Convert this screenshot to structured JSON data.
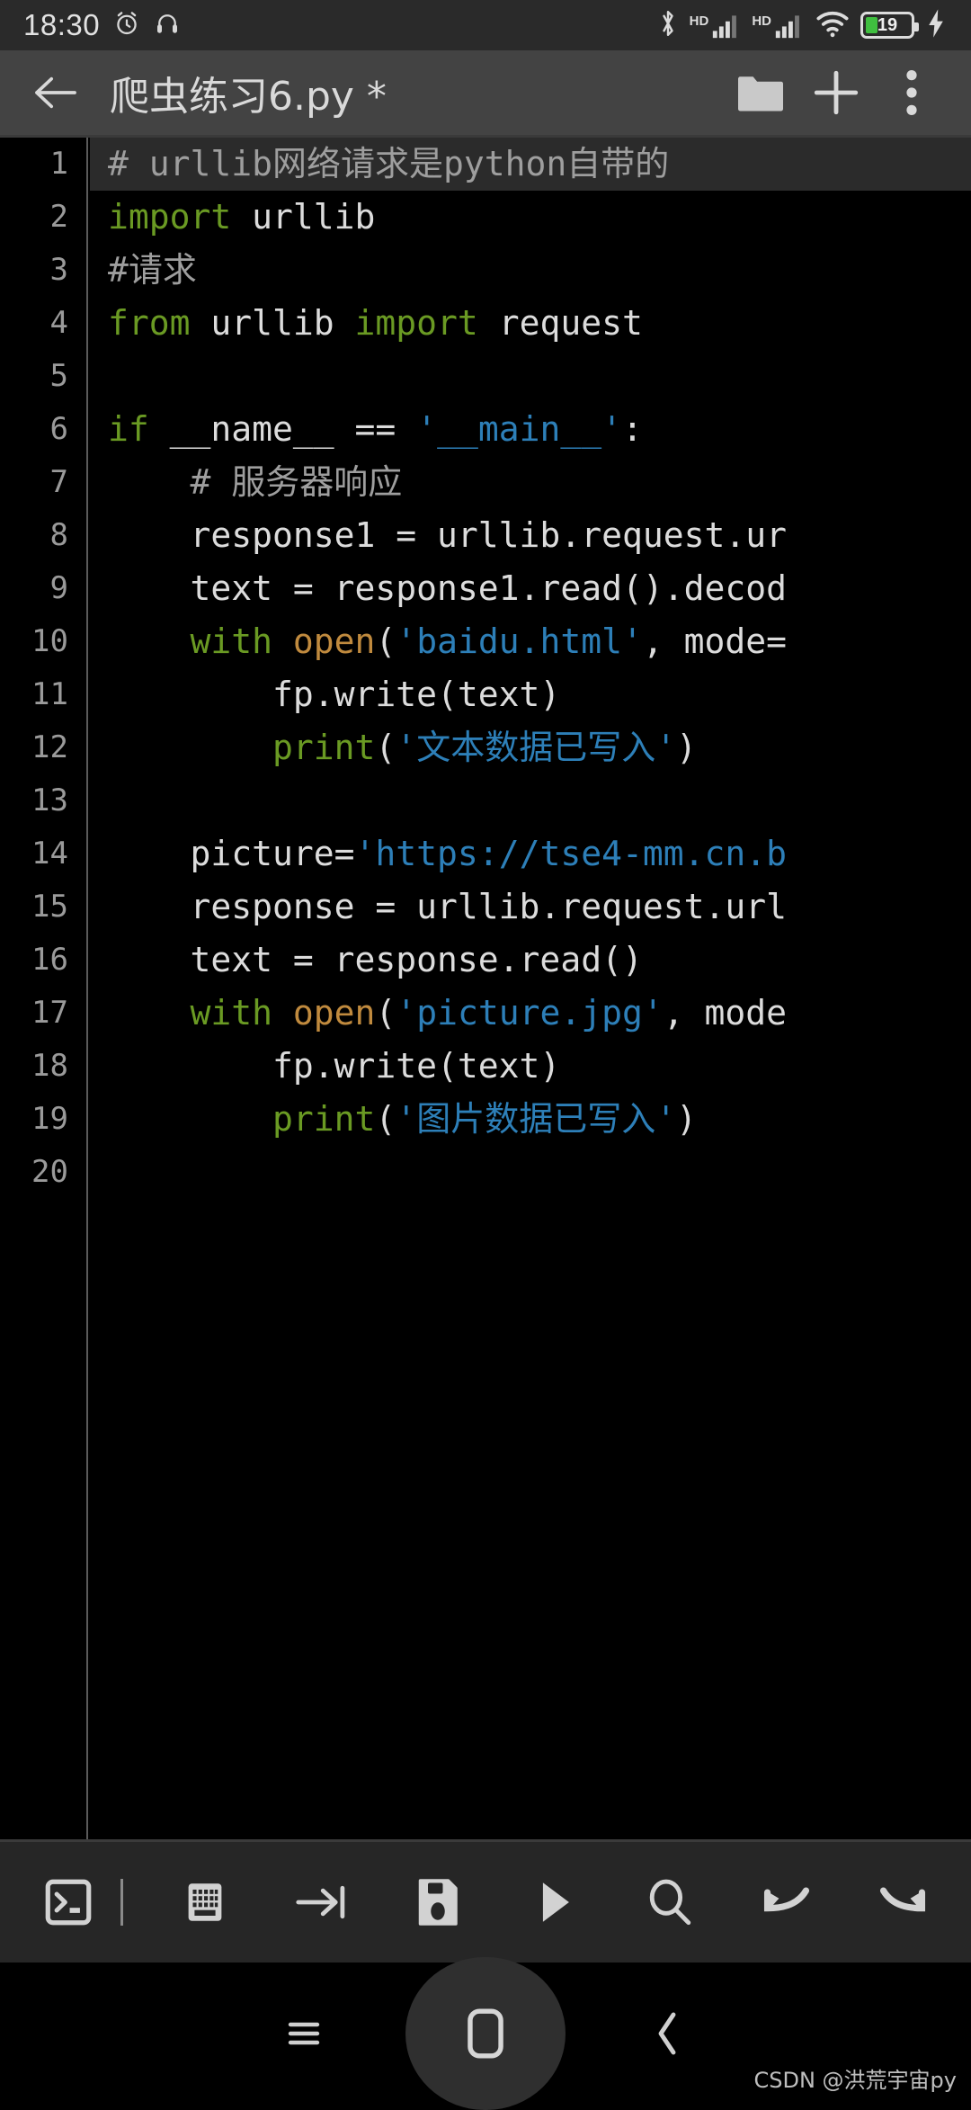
{
  "status_bar": {
    "time": "18:30",
    "icons_left": [
      "alarm-clock-icon",
      "headphones-icon"
    ],
    "icons_right": [
      "bluetooth-icon",
      "signal-hd-1-icon",
      "signal-hd-2-icon",
      "wifi-icon",
      "battery-icon",
      "charging-bolt-icon"
    ],
    "hd_label_1": "HD",
    "hd_label_2": "HD",
    "battery_percent": "19",
    "battery_color": "#3fbf3f"
  },
  "app_bar": {
    "back_icon": "arrow-left-icon",
    "title": "爬虫练习6.py *",
    "actions": [
      {
        "name": "folder-open-icon",
        "label": "folder"
      },
      {
        "name": "add-new-file-icon",
        "label": "+"
      },
      {
        "name": "overflow-menu-icon",
        "label": "⋮"
      }
    ]
  },
  "editor": {
    "current_line": 1,
    "total_lines": 20,
    "line_numbers": [
      "1",
      "2",
      "3",
      "4",
      "5",
      "6",
      "7",
      "8",
      "9",
      "10",
      "11",
      "12",
      "13",
      "14",
      "15",
      "16",
      "17",
      "18",
      "19",
      "20"
    ],
    "lines": [
      {
        "n": 1,
        "tokens": [
          {
            "t": "# urllib网络请求是python自带的",
            "c": "cmt"
          }
        ]
      },
      {
        "n": 2,
        "tokens": [
          {
            "t": "import",
            "c": "kw"
          },
          {
            "t": " urllib",
            "c": "def"
          }
        ]
      },
      {
        "n": 3,
        "tokens": [
          {
            "t": "#请求",
            "c": "cmt"
          }
        ]
      },
      {
        "n": 4,
        "tokens": [
          {
            "t": "from",
            "c": "kw"
          },
          {
            "t": " urllib ",
            "c": "def"
          },
          {
            "t": "import",
            "c": "kw"
          },
          {
            "t": " request",
            "c": "def"
          }
        ]
      },
      {
        "n": 5,
        "tokens": []
      },
      {
        "n": 6,
        "tokens": [
          {
            "t": "if",
            "c": "kw"
          },
          {
            "t": " __name__ == ",
            "c": "def"
          },
          {
            "t": "'__main__'",
            "c": "str"
          },
          {
            "t": ":",
            "c": "def"
          }
        ]
      },
      {
        "n": 7,
        "tokens": [
          {
            "t": "    # 服务器响应",
            "c": "cmt"
          }
        ]
      },
      {
        "n": 8,
        "tokens": [
          {
            "t": "    response1 = urllib.request.ur",
            "c": "def"
          }
        ]
      },
      {
        "n": 9,
        "tokens": [
          {
            "t": "    text = response1.read().decod",
            "c": "def"
          }
        ]
      },
      {
        "n": 10,
        "tokens": [
          {
            "t": "    ",
            "c": "def"
          },
          {
            "t": "with",
            "c": "kw"
          },
          {
            "t": " ",
            "c": "def"
          },
          {
            "t": "open",
            "c": "fn"
          },
          {
            "t": "(",
            "c": "def"
          },
          {
            "t": "'baidu.html'",
            "c": "str"
          },
          {
            "t": ", mode=",
            "c": "def"
          }
        ]
      },
      {
        "n": 11,
        "tokens": [
          {
            "t": "        fp.write(text)",
            "c": "def"
          }
        ]
      },
      {
        "n": 12,
        "tokens": [
          {
            "t": "        ",
            "c": "def"
          },
          {
            "t": "print",
            "c": "kw"
          },
          {
            "t": "(",
            "c": "def"
          },
          {
            "t": "'文本数据已写入'",
            "c": "str"
          },
          {
            "t": ")",
            "c": "def"
          }
        ]
      },
      {
        "n": 13,
        "tokens": []
      },
      {
        "n": 14,
        "tokens": [
          {
            "t": "    picture=",
            "c": "def"
          },
          {
            "t": "'https://tse4-mm.cn.b",
            "c": "str"
          }
        ]
      },
      {
        "n": 15,
        "tokens": [
          {
            "t": "    response = urllib.request.url",
            "c": "def"
          }
        ]
      },
      {
        "n": 16,
        "tokens": [
          {
            "t": "    text = response.read()",
            "c": "def"
          }
        ]
      },
      {
        "n": 17,
        "tokens": [
          {
            "t": "    ",
            "c": "def"
          },
          {
            "t": "with",
            "c": "kw"
          },
          {
            "t": " ",
            "c": "def"
          },
          {
            "t": "open",
            "c": "fn"
          },
          {
            "t": "(",
            "c": "def"
          },
          {
            "t": "'picture.jpg'",
            "c": "str"
          },
          {
            "t": ", mode",
            "c": "def"
          }
        ]
      },
      {
        "n": 18,
        "tokens": [
          {
            "t": "        fp.write(text)",
            "c": "def"
          }
        ]
      },
      {
        "n": 19,
        "tokens": [
          {
            "t": "        ",
            "c": "def"
          },
          {
            "t": "print",
            "c": "kw"
          },
          {
            "t": "(",
            "c": "def"
          },
          {
            "t": "'图片数据已写入'",
            "c": "str"
          },
          {
            "t": ")",
            "c": "def"
          }
        ]
      },
      {
        "n": 20,
        "tokens": []
      }
    ],
    "colors": {
      "background": "#000000",
      "current_line_bg": "#2b2b2b",
      "default_text": "#dcdcdc",
      "comment": "#9e9e9e",
      "keyword": "#6a9a23",
      "string": "#2d7fb8",
      "function": "#c08a3e",
      "gutter_text": "#9a9a9a"
    }
  },
  "toolbar": {
    "items": [
      {
        "name": "terminal-icon",
        "label": "Terminal"
      },
      {
        "name": "toolbar-separator",
        "label": ""
      },
      {
        "name": "keyboard-icon",
        "label": "Keyboard"
      },
      {
        "name": "indent-tab-icon",
        "label": "Tab"
      },
      {
        "name": "save-icon",
        "label": "Save"
      },
      {
        "name": "run-icon",
        "label": "Run"
      },
      {
        "name": "search-icon",
        "label": "Search"
      },
      {
        "name": "undo-icon",
        "label": "Undo"
      },
      {
        "name": "redo-icon",
        "label": "Redo"
      }
    ]
  },
  "nav_bar": {
    "items": [
      {
        "name": "nav-recents-icon",
        "label": "Recents"
      },
      {
        "name": "nav-home-icon",
        "label": "Home"
      },
      {
        "name": "nav-back-icon",
        "label": "Back"
      }
    ]
  },
  "watermark": {
    "text": "CSDN @洪荒宇宙py"
  }
}
